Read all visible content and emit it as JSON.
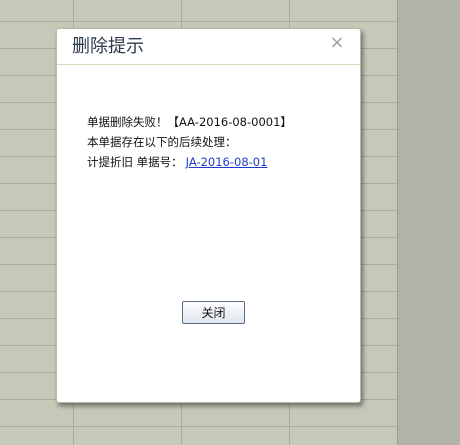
{
  "dialog": {
    "title": "删除提示",
    "close_icon": "×",
    "message_line1": "单据删除失败！【AA-2016-08-0001】",
    "message_line2": "本单据存在以下的后续处理：",
    "message_line3_label": "计提折旧 单据号：",
    "message_line3_link": "JA-2016-08-01",
    "button_close_label": "关闭"
  },
  "colors": {
    "link": "#1f3cc8",
    "title_text": "#2c3a4c",
    "grid_background": "#c5c9b8"
  }
}
